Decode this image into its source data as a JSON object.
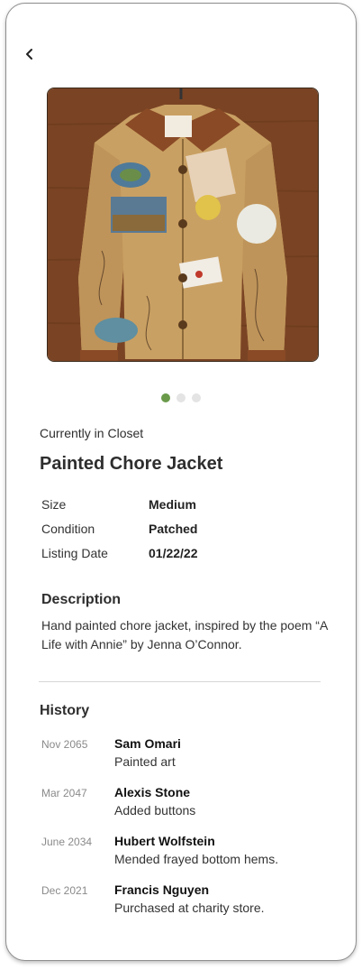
{
  "header": {
    "back_icon": "chevron-left-icon"
  },
  "carousel": {
    "image_alt": "Hand painted chore jacket hanging on wooden wall",
    "total": 3,
    "active": 1
  },
  "item": {
    "status": "Currently in Closet",
    "title": "Painted Chore Jacket",
    "details": [
      {
        "label": "Size",
        "value": "Medium"
      },
      {
        "label": "Condition",
        "value": "Patched"
      },
      {
        "label": "Listing Date",
        "value": "01/22/22"
      }
    ]
  },
  "description": {
    "heading": "Description",
    "text": "Hand painted chore jacket, inspired by the poem “A Life with Annie” by Jenna O’Connor."
  },
  "history": {
    "heading": "History",
    "entries": [
      {
        "date": "Nov 2065",
        "name": "Sam Omari",
        "note": "Painted art"
      },
      {
        "date": "Mar 2047",
        "name": "Alexis Stone",
        "note": "Added buttons"
      },
      {
        "date": "June 2034",
        "name": "Hubert Wolfstein",
        "note": "Mended frayed bottom hems."
      },
      {
        "date": "Dec 2021",
        "name": "Francis Nguyen",
        "note": "Purchased at charity store."
      }
    ]
  },
  "colors": {
    "accent": "#6a9a4a",
    "dot_inactive": "#e4e4e4",
    "jacket": "#c9a063",
    "wall": "#7a4424"
  }
}
